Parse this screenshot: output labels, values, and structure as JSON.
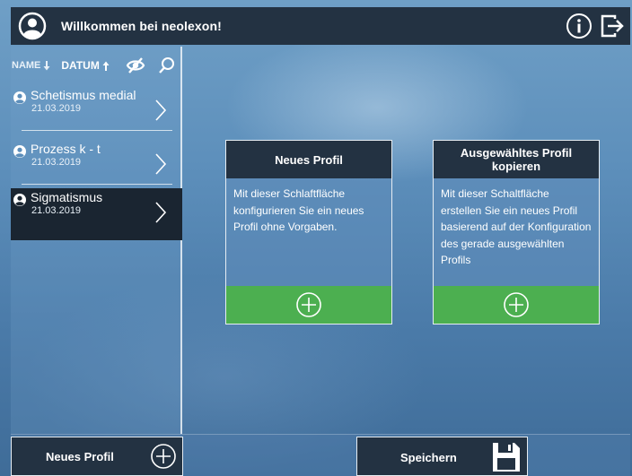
{
  "header": {
    "title": "Willkommen bei neolexon!"
  },
  "sidebar": {
    "sort_name_label": "NAME",
    "sort_date_label": "DATUM",
    "items": [
      {
        "name": "Schetismus medial",
        "date": "21.03.2019",
        "active": false
      },
      {
        "name": "Prozess k - t",
        "date": "21.03.2019",
        "active": false
      },
      {
        "name": "Sigmatismus",
        "date": "21.03.2019",
        "active": true
      }
    ]
  },
  "cards": [
    {
      "title": "Neues Profil",
      "description": "Mit dieser Schlaftfläche konfigurieren Sie ein neues Profil ohne Vorgaben."
    },
    {
      "title": "Ausgewähltes Profil kopieren",
      "description": "Mit dieser Schaltfläche erstellen Sie ein neues Profil basierend auf der Konfiguration des gerade ausgewählten Profils"
    }
  ],
  "footer": {
    "new_profile_label": "Neues Profil",
    "save_label": "Speichern"
  },
  "colors": {
    "dark_panel": "#233242",
    "active_item": "#1a2531",
    "add_green": "#4caf50"
  }
}
